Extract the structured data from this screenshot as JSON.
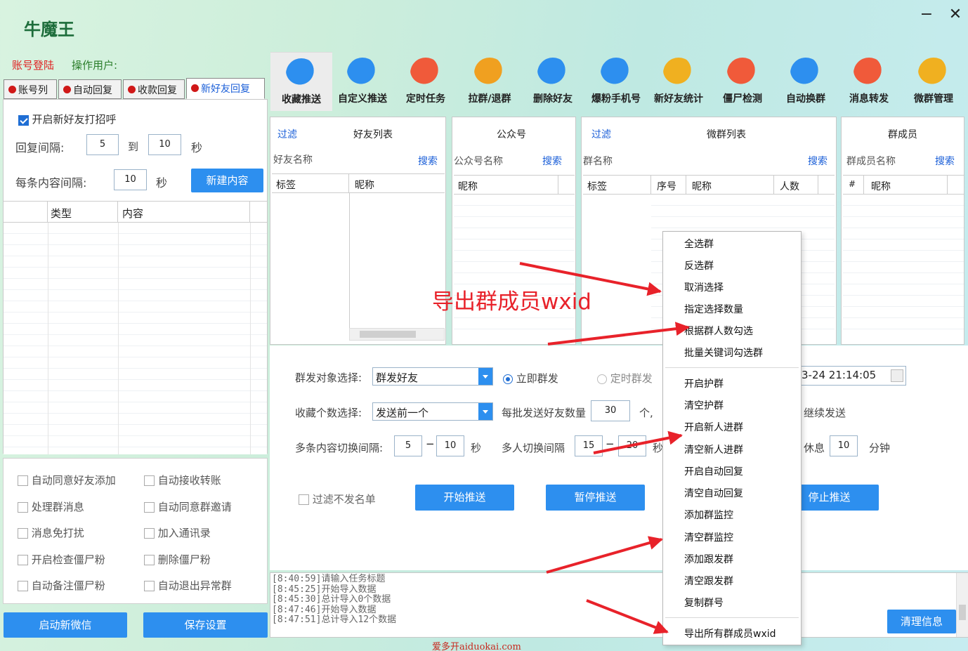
{
  "app": {
    "title": "牛魔王",
    "minimize": "−",
    "close": "✕"
  },
  "login": {
    "status": "账号登陆",
    "operator": "操作用户:"
  },
  "left_tabs": [
    "账号列",
    "自动回复",
    "收款回复",
    "新好友回复"
  ],
  "greeting": {
    "enable_label": "开启新好友打招呼",
    "reply_interval_label": "回复间隔:",
    "reply_from": "5",
    "to_label": "到",
    "reply_to": "10",
    "sec": "秒",
    "item_interval_label": "每条内容间隔:",
    "item_interval": "10",
    "sec2": "秒",
    "new_content": "新建内容",
    "grid_cols": [
      "",
      "类型",
      "内容"
    ]
  },
  "options": [
    [
      "自动同意好友添加",
      "自动接收转账"
    ],
    [
      "处理群消息",
      "自动同意群邀请"
    ],
    [
      "消息免打扰",
      "加入通讯录"
    ],
    [
      "开启检查僵尸粉",
      "删除僵尸粉"
    ],
    [
      "自动备注僵尸粉",
      "自动退出异常群"
    ]
  ],
  "left_buttons": {
    "start": "启动新微信",
    "save": "保存设置"
  },
  "toolbar": [
    {
      "label": "收藏推送",
      "icon": "favorite-push-icon",
      "color": "#2d8fef"
    },
    {
      "label": "自定义推送",
      "icon": "custom-push-icon",
      "color": "#2d8fef"
    },
    {
      "label": "定时任务",
      "icon": "scheduled-task-icon",
      "color": "#f05a3a"
    },
    {
      "label": "拉群/退群",
      "icon": "group-pull-icon",
      "color": "#f0a020"
    },
    {
      "label": "删除好友",
      "icon": "delete-friend-icon",
      "color": "#2d8fef"
    },
    {
      "label": "爆粉手机号",
      "icon": "phone-fans-icon",
      "color": "#2d8fef"
    },
    {
      "label": "新好友统计",
      "icon": "new-friend-stats-icon",
      "color": "#f0b020"
    },
    {
      "label": "僵尸检测",
      "icon": "zombie-detect-icon",
      "color": "#f05a3a"
    },
    {
      "label": "自动换群",
      "icon": "auto-switch-group-icon",
      "color": "#2d8fef"
    },
    {
      "label": "消息转发",
      "icon": "message-forward-icon",
      "color": "#f05a3a"
    },
    {
      "label": "微群管理",
      "icon": "group-manage-icon",
      "color": "#f0b020"
    }
  ],
  "panels": {
    "friends": {
      "filter": "过滤",
      "title": "好友列表",
      "search_label": "好友名称",
      "search": "搜索",
      "cols": [
        "标签",
        "昵称"
      ]
    },
    "official": {
      "title": "公众号",
      "search_label": "公众号名称",
      "search": "搜索",
      "cols": [
        "昵称"
      ]
    },
    "groups": {
      "filter": "过滤",
      "title": "微群列表",
      "search_label": "群名称",
      "search": "搜索",
      "cols": [
        "标签",
        "序号",
        "昵称",
        "人数"
      ]
    },
    "members": {
      "title": "群成员",
      "search_label": "群成员名称",
      "search": "搜索",
      "cols": [
        "#",
        "昵称"
      ]
    }
  },
  "form": {
    "target_label": "群发对象选择:",
    "target_value": "群发好友",
    "radio_now": "立即群发",
    "radio_timed": "定时群发",
    "datetime": "3-24 21:14:05",
    "fav_count_label": "收藏个数选择:",
    "fav_count_value": "发送前一个",
    "batch_label": "每批发送好友数量",
    "batch_value": "30",
    "batch_unit": "个,",
    "continue_send": "继续发送",
    "switch_label": "多条内容切换间隔:",
    "switch_from": "5",
    "switch_to": "10",
    "switch_sec": "秒",
    "multi_label": "多人切换间隔",
    "multi_from": "15",
    "multi_to": "20",
    "multi_sec": "秒",
    "rest_label": "休息",
    "rest_value": "10",
    "rest_unit": "分钟",
    "skip_label": "过滤不发名单",
    "start": "开始推送",
    "pause": "暂停推送",
    "stop": "停止推送"
  },
  "log": {
    "lines": [
      "[8:40:59]请输入任务标题",
      "[8:45:25]开始导入数据",
      "[8:45:30]总计导入0个数据",
      "[8:47:46]开始导入数据",
      "[8:47:51]总计导入12个数据"
    ],
    "clear": "清理信息"
  },
  "menu": {
    "group1": [
      "全选群",
      "反选群",
      "取消选择",
      "指定选择数量",
      "根据群人数勾选",
      "批量关键词勾选群"
    ],
    "group2": [
      "开启护群",
      "清空护群",
      "开启新人进群",
      "清空新人进群",
      "开启自动回复",
      "清空自动回复",
      "添加群监控",
      "清空群监控",
      "添加跟发群",
      "清空跟发群",
      "复制群号"
    ],
    "group3": [
      "导出所有群成员wxid"
    ]
  },
  "annotation": "导出群成员wxid",
  "watermark": "爱多开aiduokai.com",
  "colors": {
    "accent": "#2d8fef",
    "arrow": "#e8222a"
  }
}
